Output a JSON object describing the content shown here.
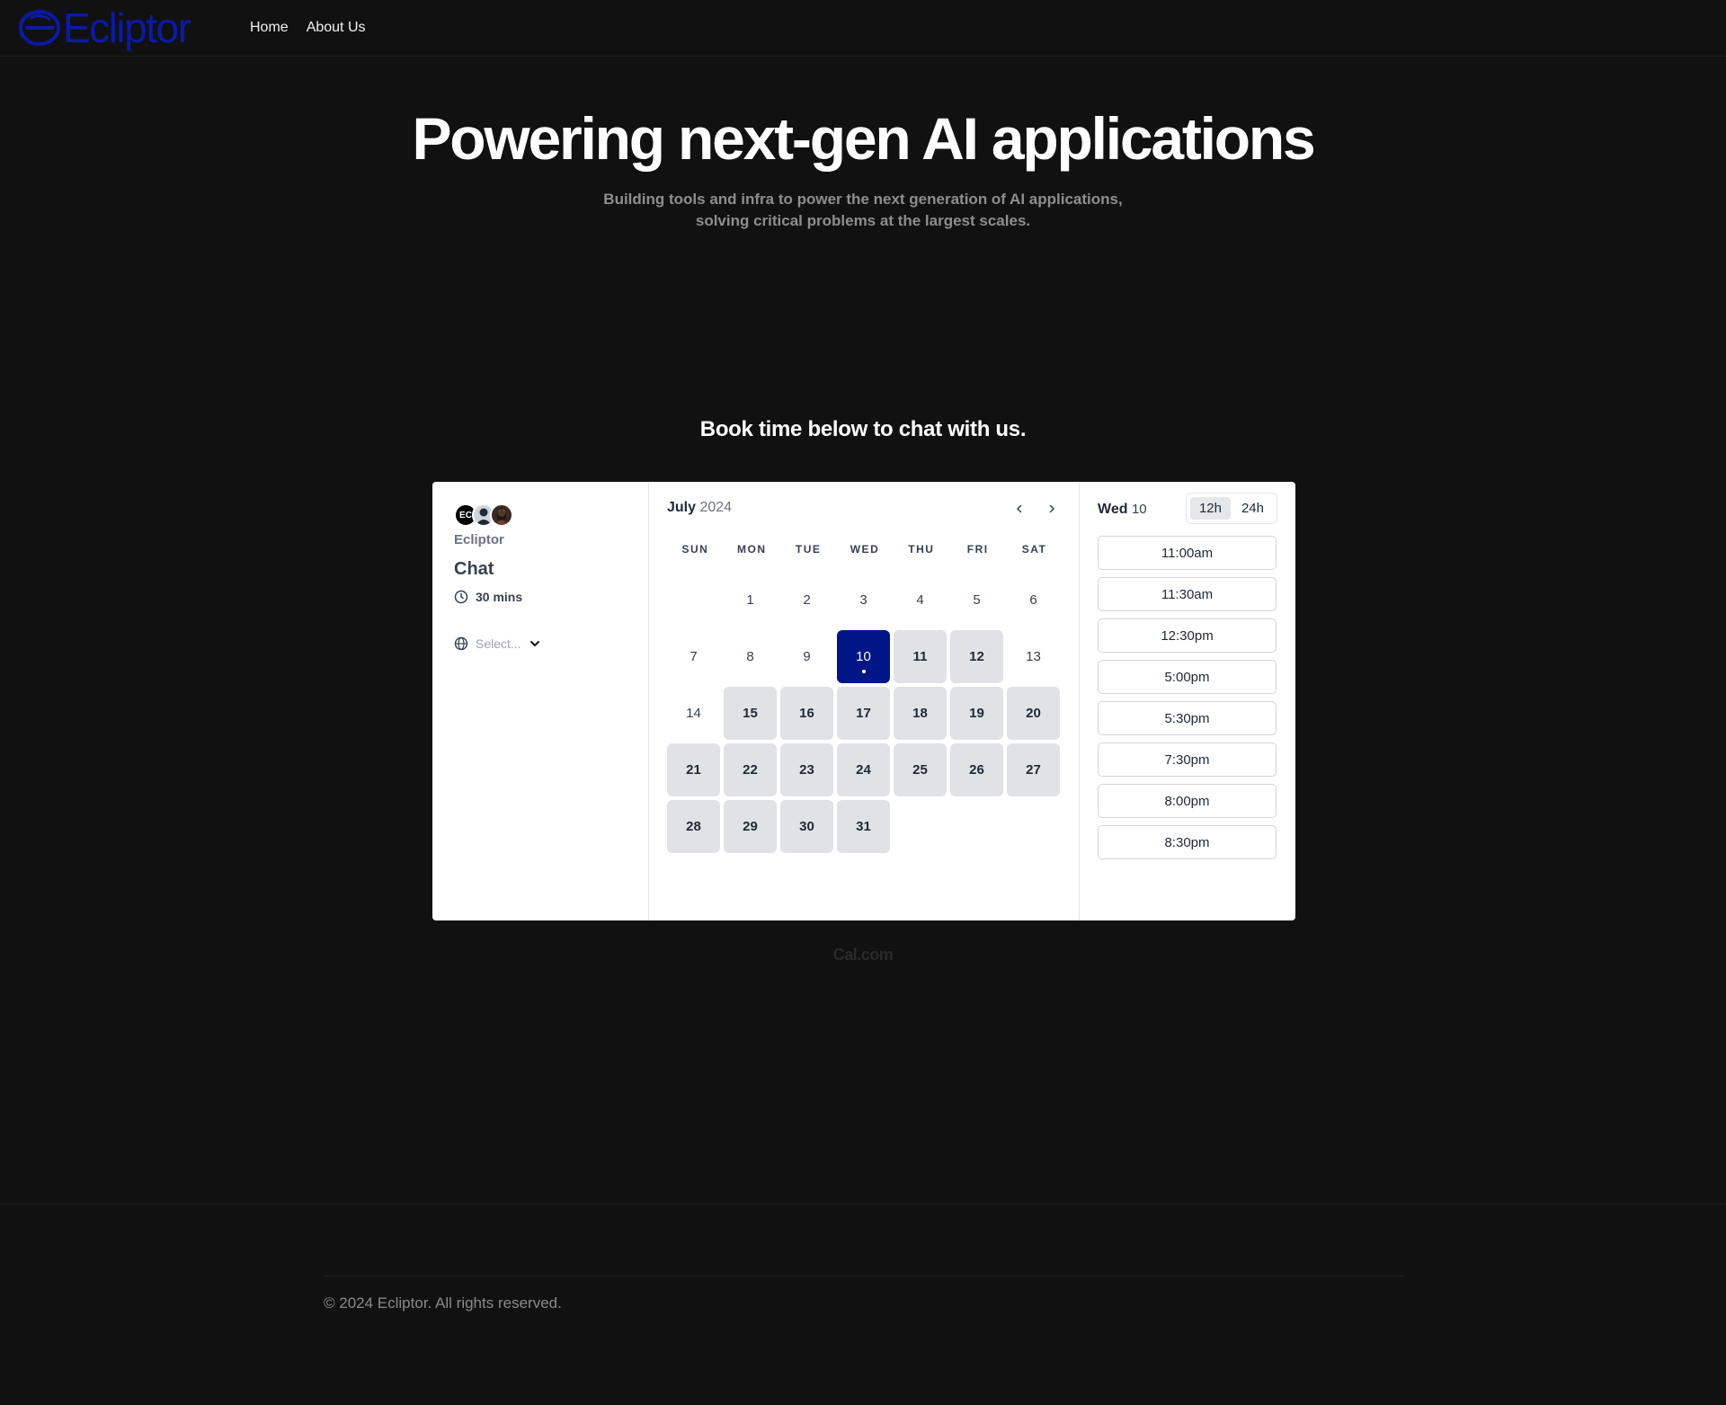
{
  "nav": {
    "brand": "Ecliptor",
    "brand_color": "#0a1aa8",
    "links": [
      {
        "label": "Home"
      },
      {
        "label": "About Us"
      }
    ]
  },
  "hero": {
    "title": "Powering next-gen AI applications",
    "subtitle_line1": "Building tools and infra to power the next generation of AI applications,",
    "subtitle_line2": "solving critical problems at the largest scales."
  },
  "booking": {
    "heading": "Book time below to chat with us.",
    "meta": {
      "avatar_initials": "EC",
      "org": "Ecliptor",
      "event": "Chat",
      "duration": "30 mins",
      "duration_icon": "clock-icon",
      "timezone_placeholder": "Select...",
      "timezone_icon": "globe-icon"
    },
    "calendar": {
      "month": "July",
      "year": "2024",
      "weekdays": [
        "SUN",
        "MON",
        "TUE",
        "WED",
        "THU",
        "FRI",
        "SAT"
      ],
      "first_weekday_index": 1,
      "days_in_month": 31,
      "selected_day": 10,
      "available_days": [
        11,
        12,
        15,
        16,
        17,
        18,
        19,
        20,
        21,
        22,
        23,
        24,
        25,
        26,
        27,
        28,
        29,
        30,
        31
      ],
      "selected_color": "#001687",
      "available_color": "#e1e2e6"
    },
    "slots": {
      "day_label": "Wed",
      "day_number": "10",
      "format_options": [
        "12h",
        "24h"
      ],
      "format_selected": "12h",
      "times": [
        "11:00am",
        "11:30am",
        "12:30pm",
        "5:00pm",
        "5:30pm",
        "7:30pm",
        "8:00pm",
        "8:30pm"
      ]
    },
    "powered_by": "Cal.com"
  },
  "footer": {
    "copyright": "© 2024 Ecliptor. All rights reserved."
  }
}
